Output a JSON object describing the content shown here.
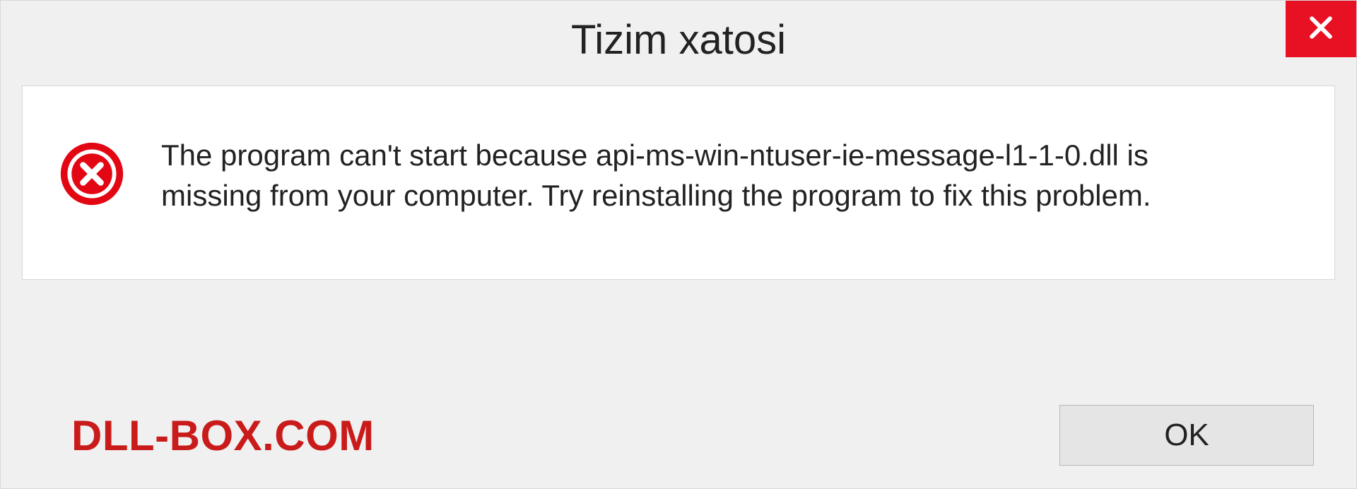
{
  "dialog": {
    "title": "Tizim xatosi",
    "message": "The program can't start because api-ms-win-ntuser-ie-message-l1-1-0.dll is missing from your computer. Try reinstalling the program to fix this problem.",
    "ok_label": "OK"
  },
  "watermark": "DLL-BOX.COM"
}
